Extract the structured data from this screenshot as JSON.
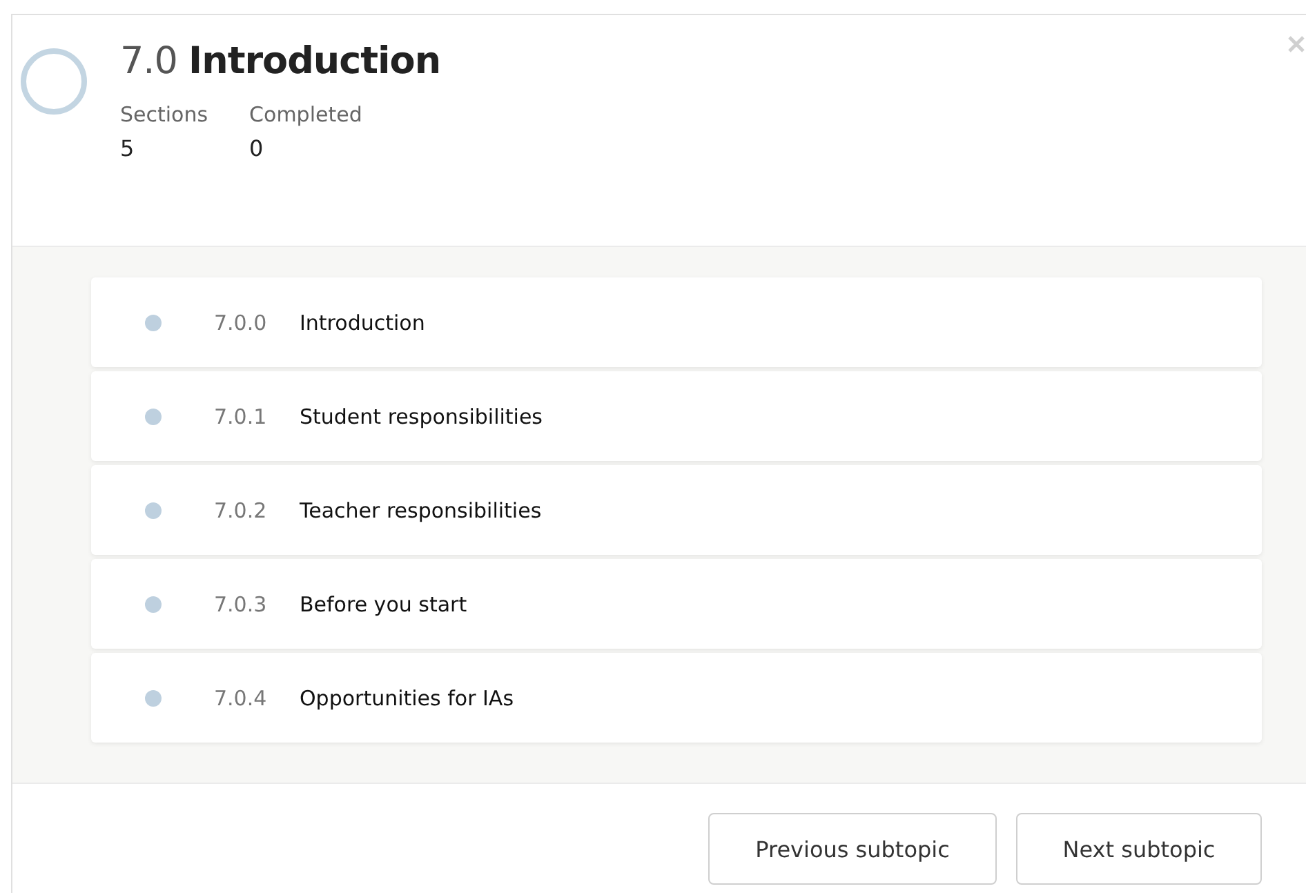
{
  "header": {
    "number": "7.0",
    "title": "Introduction",
    "stats": [
      {
        "label": "Sections",
        "value": "5"
      },
      {
        "label": "Completed",
        "value": "0"
      }
    ]
  },
  "sections": [
    {
      "number": "7.0.0",
      "title": "Introduction"
    },
    {
      "number": "7.0.1",
      "title": "Student responsibilities"
    },
    {
      "number": "7.0.2",
      "title": "Teacher responsibilities"
    },
    {
      "number": "7.0.3",
      "title": "Before you start"
    },
    {
      "number": "7.0.4",
      "title": "Opportunities for IAs"
    }
  ],
  "buttons": [
    "Previous subtopic",
    "Next subtopic"
  ]
}
